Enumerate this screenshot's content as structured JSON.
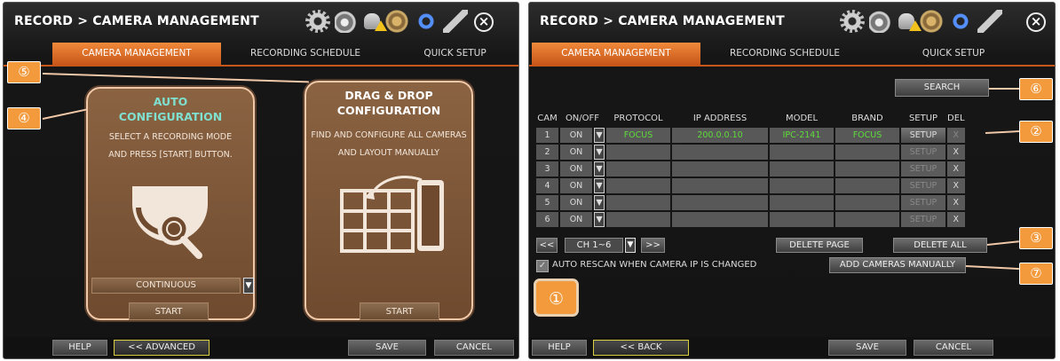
{
  "left": {
    "title": "RECORD > CAMERA MANAGEMENT",
    "tabs": [
      "CAMERA MANAGEMENT",
      "RECORDING SCHEDULE",
      "QUICK SETUP"
    ],
    "auto": {
      "title_line1": "AUTO",
      "title_line2": "CONFIGURATION",
      "desc_line1": "SELECT A RECORDING MODE",
      "desc_line2": "AND PRESS [START] BUTTON.",
      "mode_value": "CONTINUOUS",
      "start_label": "START"
    },
    "drag": {
      "title_line1": "DRAG & DROP",
      "title_line2": "CONFIGURATION",
      "desc_line1": "FIND AND CONFIGURE ALL CAMERAS",
      "desc_line2": "AND LAYOUT MANUALLY",
      "start_label": "START"
    },
    "bottom": {
      "help": "HELP",
      "advanced": "<< ADVANCED",
      "save": "SAVE",
      "cancel": "CANCEL"
    },
    "markers": {
      "m4": "④",
      "m5": "⑤"
    }
  },
  "right": {
    "title": "RECORD > CAMERA MANAGEMENT",
    "tabs": [
      "CAMERA MANAGEMENT",
      "RECORDING SCHEDULE",
      "QUICK SETUP"
    ],
    "search_label": "SEARCH",
    "columns": [
      "CAM",
      "ON/OFF",
      "PROTOCOL",
      "IP ADDRESS",
      "MODEL",
      "BRAND",
      "SETUP",
      "DEL"
    ],
    "rows": [
      {
        "cam": "1",
        "on": "ON",
        "protocol": "FOCUS",
        "ip": "200.0.0.10",
        "model": "IPC-2141",
        "brand": "FOCUS",
        "setup": "SETUP",
        "del": "X"
      },
      {
        "cam": "2",
        "on": "ON",
        "protocol": "",
        "ip": "",
        "model": "",
        "brand": "",
        "setup": "SETUP",
        "del": "X"
      },
      {
        "cam": "3",
        "on": "ON",
        "protocol": "",
        "ip": "",
        "model": "",
        "brand": "",
        "setup": "SETUP",
        "del": "X"
      },
      {
        "cam": "4",
        "on": "ON",
        "protocol": "",
        "ip": "",
        "model": "",
        "brand": "",
        "setup": "SETUP",
        "del": "X"
      },
      {
        "cam": "5",
        "on": "ON",
        "protocol": "",
        "ip": "",
        "model": "",
        "brand": "",
        "setup": "SETUP",
        "del": "X"
      },
      {
        "cam": "6",
        "on": "ON",
        "protocol": "",
        "ip": "",
        "model": "",
        "brand": "",
        "setup": "SETUP",
        "del": "X"
      }
    ],
    "pager": {
      "prev": "<<",
      "range": "CH 1~6",
      "next": ">>"
    },
    "delete_page": "DELETE PAGE",
    "delete_all": "DELETE ALL",
    "auto_rescan": "AUTO RESCAN WHEN CAMERA IP IS CHANGED",
    "add_manual": "ADD CAMERAS MANUALLY",
    "bottom": {
      "help": "HELP",
      "back": "<< BACK",
      "save": "SAVE",
      "cancel": "CANCEL"
    },
    "markers": {
      "m1": "①",
      "m2": "②",
      "m3": "③",
      "m6": "⑥",
      "m7": "⑦"
    }
  },
  "colors": {
    "accent": "#e07a2e",
    "card": "#7a5538",
    "title_teal": "#7fe0d0",
    "marker": "#f39a3d",
    "green": "#5fdc3a"
  }
}
